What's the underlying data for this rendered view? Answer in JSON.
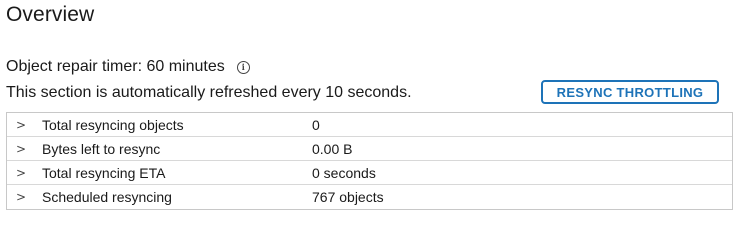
{
  "overview": {
    "title": "Overview",
    "timer_text": "Object repair timer: 60 minutes",
    "info_glyph": "i",
    "refresh_text": "This section is automatically refreshed every 10 seconds.",
    "throttle_button_label": "RESYNC THROTTLING"
  },
  "colors": {
    "accent": "#1d73b8"
  },
  "table": {
    "rows": [
      {
        "label": "Total resyncing objects",
        "value": "0",
        "icon": "chevron-right-icon",
        "glyph": ">"
      },
      {
        "label": "Bytes left to resync",
        "value": "0.00 B",
        "icon": "chevron-right-icon",
        "glyph": ">"
      },
      {
        "label": "Total resyncing ETA",
        "value": "0 seconds",
        "icon": "chevron-right-icon",
        "glyph": ">"
      },
      {
        "label": "Scheduled resyncing",
        "value": "767 objects",
        "icon": "chevron-right-icon",
        "glyph": ">"
      }
    ]
  }
}
